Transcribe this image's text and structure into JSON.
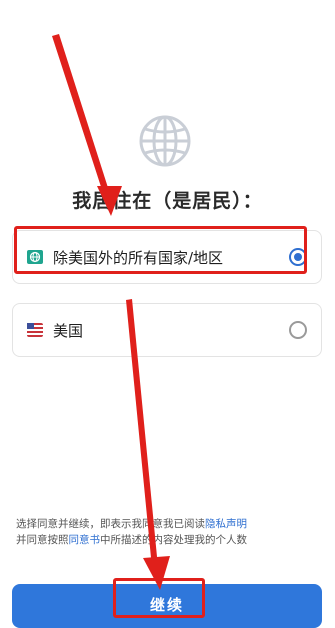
{
  "header": {
    "title": "我居住在（是居民）："
  },
  "options": [
    {
      "label": "除美国外的所有国家/地区",
      "icon": "globe-flag-icon",
      "selected": true
    },
    {
      "label": "美国",
      "icon": "us-flag-icon",
      "selected": false
    }
  ],
  "consent": {
    "line1_before": "选择同意并继续，即表示我同意我已阅读",
    "line1_link": "隐私声明",
    "line2_before": "并同意按照",
    "line2_link": "同意书",
    "line2_after": "中所描述的内容处理我的个人数"
  },
  "footer": {
    "continue_label": "继续"
  },
  "colors": {
    "accent": "#2f6fd0",
    "button": "#2f77db",
    "annotation_red": "#e0201b"
  }
}
